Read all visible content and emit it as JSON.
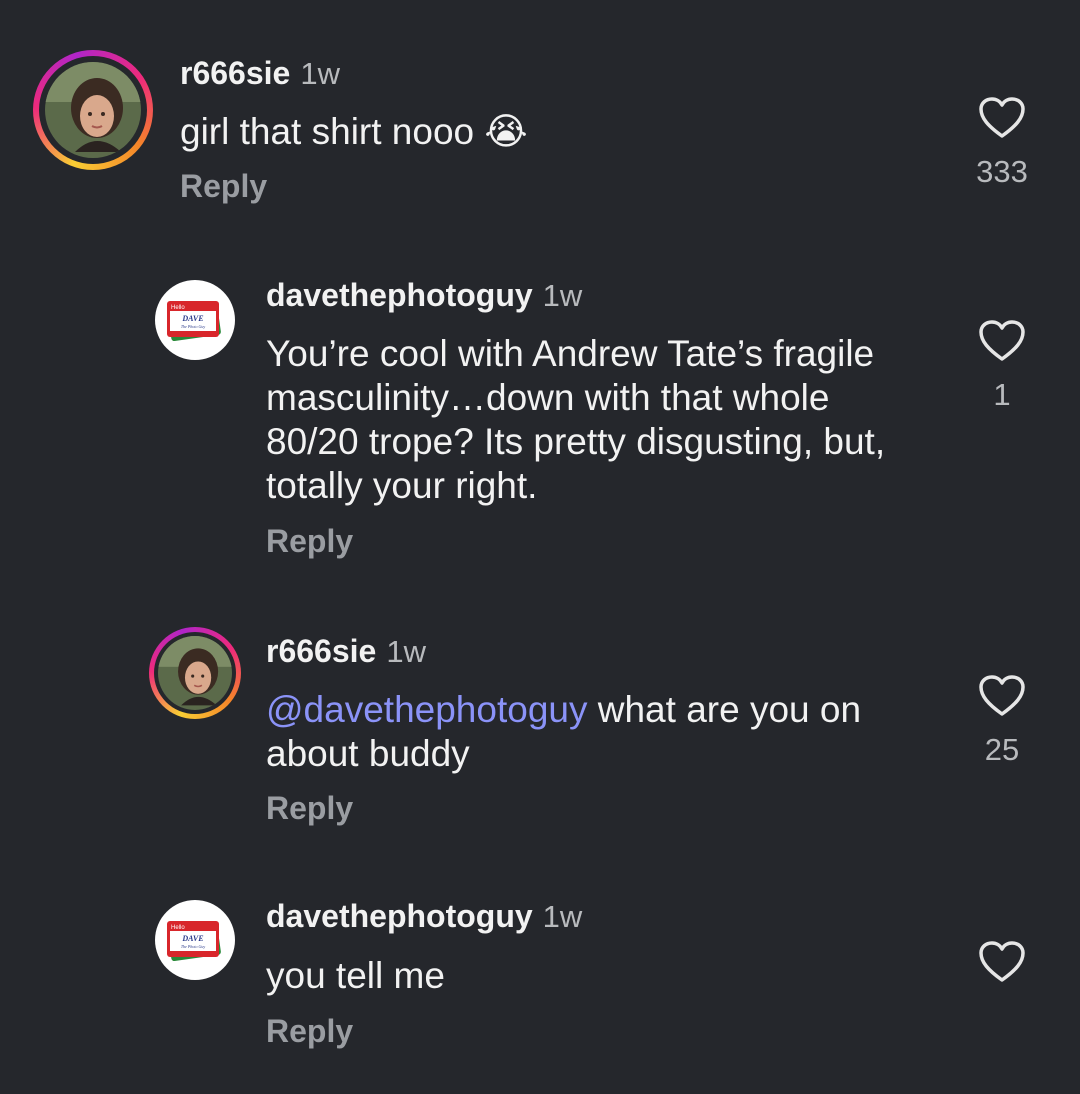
{
  "comments": [
    {
      "username": "r666sie",
      "time": "1w",
      "text": "girl that shirt nooo",
      "emoji": "😭",
      "reply": "Reply",
      "likes": "333",
      "avatar": "profile-photo"
    },
    {
      "username": "davethephotoguy",
      "time": "1w",
      "text": "You’re cool with Andrew Tate’s fragile masculinity…down with that whole 80/20 trope? Its pretty disgusting, but, totally your right.",
      "reply": "Reply",
      "likes": "1",
      "avatar": "hello-dave-name-tag",
      "avatar_text": {
        "hello": "Hello",
        "name": "DAVE",
        "sub": "The Photo Guy"
      }
    },
    {
      "username": "r666sie",
      "time": "1w",
      "mention": "@davethephotoguy",
      "text": " what are you on about buddy",
      "reply": "Reply",
      "likes": "25",
      "avatar": "profile-photo"
    },
    {
      "username": "davethephotoguy",
      "time": "1w",
      "text": "you tell me",
      "reply": "Reply",
      "likes": "",
      "avatar": "hello-dave-name-tag",
      "avatar_text": {
        "hello": "Hello",
        "name": "DAVE",
        "sub": "The Photo Guy"
      }
    }
  ],
  "colors": {
    "background": "#25272c",
    "mention": "#8b93f8",
    "secondary_text": "#b8babd"
  }
}
